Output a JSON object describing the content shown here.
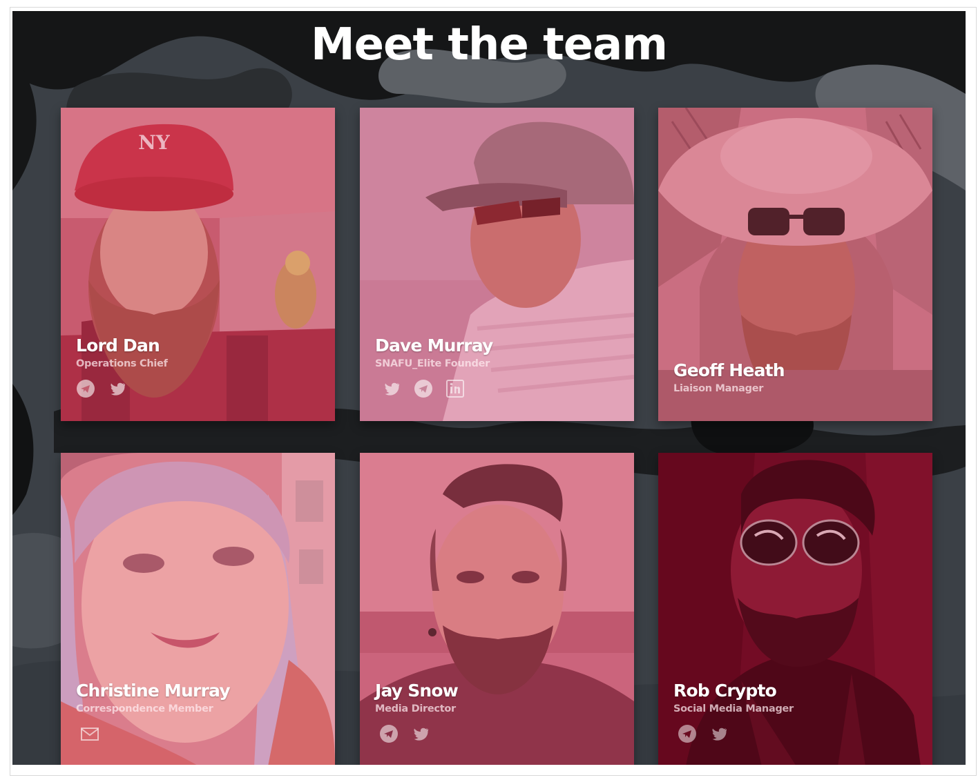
{
  "page": {
    "title": "Meet the team"
  },
  "colors": {
    "overlay": "#e0506e",
    "overlay_dark": "#8a1030",
    "panel": "#3a3f45"
  },
  "team": [
    {
      "name": "Lord Dan",
      "role": "Operations Chief",
      "icons": [
        "telegram-icon",
        "twitter-icon"
      ]
    },
    {
      "name": "Dave Murray",
      "role": "SNAFU_Elite Founder",
      "icons": [
        "twitter-icon",
        "telegram-icon",
        "linkedin-icon"
      ]
    },
    {
      "name": "Geoff Heath",
      "role": "Liaison Manager",
      "icons": []
    },
    {
      "name": "Christine Murray",
      "role": "Correspondence Member",
      "icons": [
        "email-icon"
      ]
    },
    {
      "name": "Jay Snow",
      "role": "Media Director",
      "icons": [
        "telegram-icon",
        "twitter-icon"
      ]
    },
    {
      "name": "Rob Crypto",
      "role": "Social Media Manager",
      "icons": [
        "telegram-icon",
        "twitter-icon"
      ]
    }
  ]
}
